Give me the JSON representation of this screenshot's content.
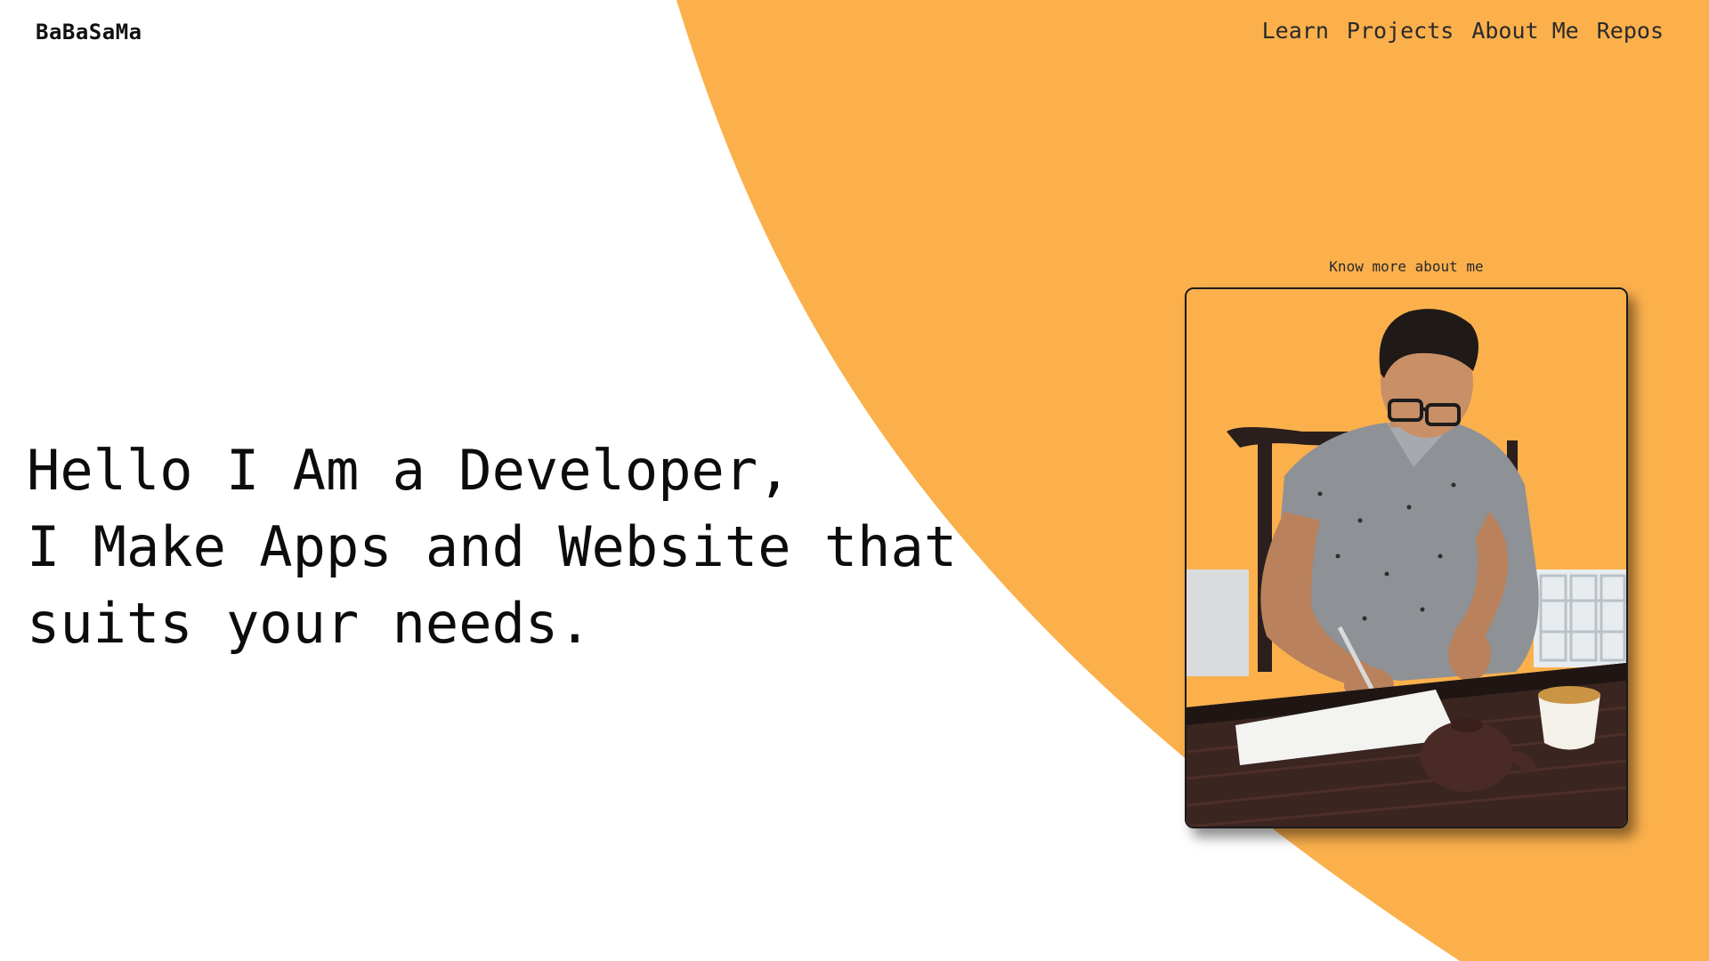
{
  "brand": {
    "name": "BaBaSaMa"
  },
  "nav": {
    "items": [
      {
        "label": "Learn"
      },
      {
        "label": "Projects"
      },
      {
        "label": "About Me"
      },
      {
        "label": "Repos"
      }
    ]
  },
  "hero": {
    "lines": [
      "Hello I Am a Developer,",
      "I Make Apps and Website that",
      "suits your needs."
    ]
  },
  "about": {
    "caption": "Know more about me"
  },
  "colors": {
    "accent": "#FBB04C",
    "background": "#FFFFFF",
    "text": "#111111"
  }
}
